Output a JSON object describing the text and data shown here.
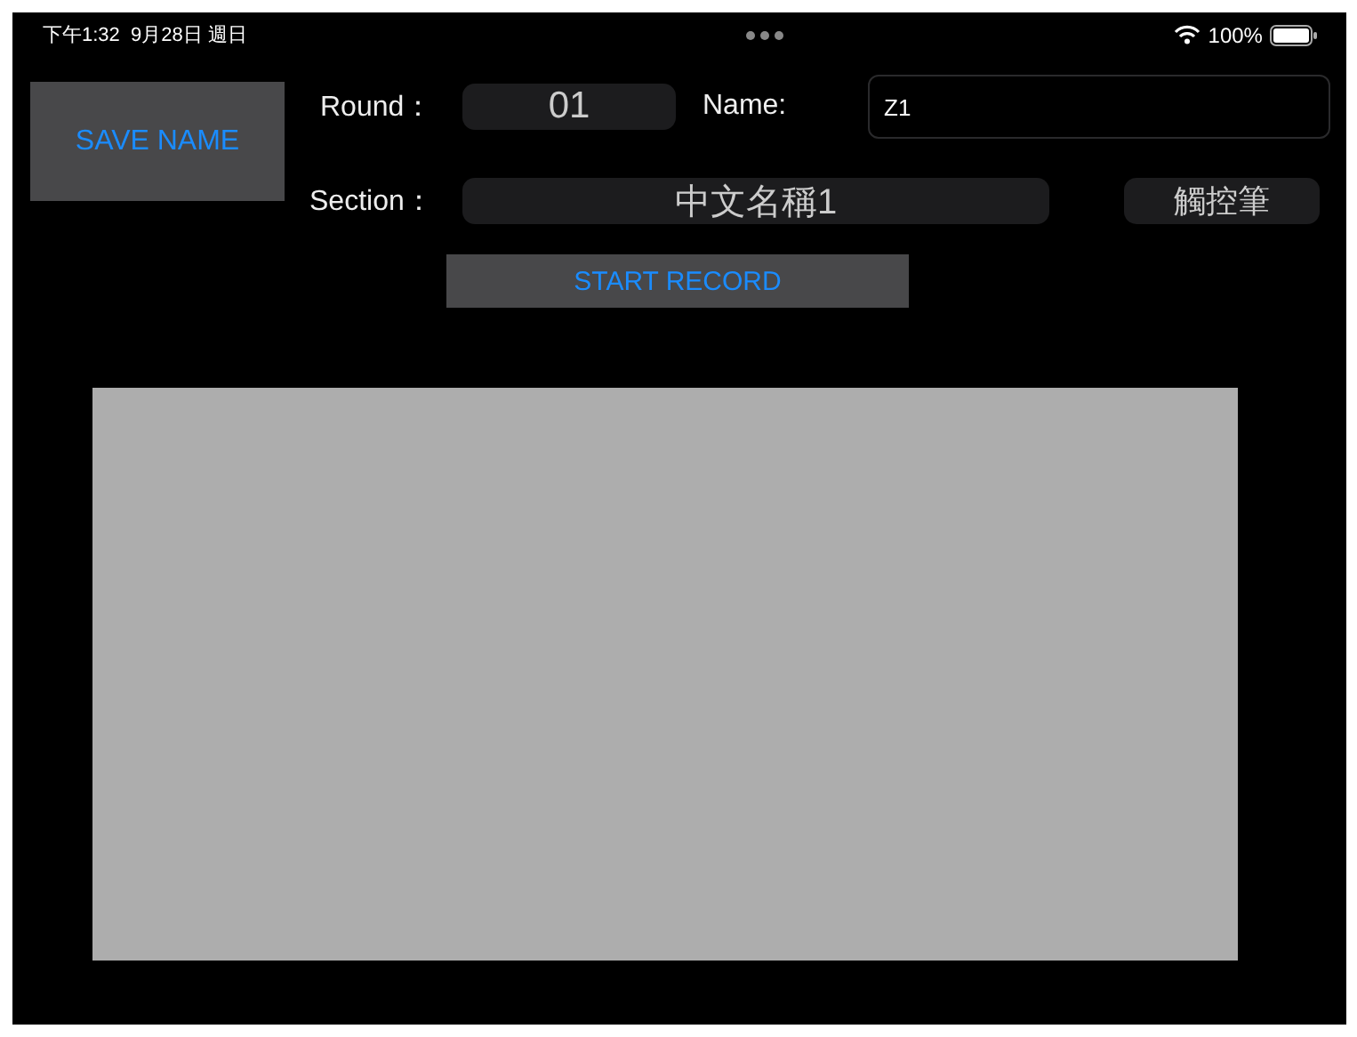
{
  "status_bar": {
    "time": "下午1:32",
    "date": "9月28日 週日",
    "battery": "100%"
  },
  "save_button": "SAVE NAME",
  "round": {
    "label": "Round：",
    "value": "01"
  },
  "name": {
    "label": "Name:",
    "value": "Z1"
  },
  "section": {
    "label": "Section：",
    "value": "中文名稱1"
  },
  "stylus_button": "觸控筆",
  "start_button": "START RECORD"
}
